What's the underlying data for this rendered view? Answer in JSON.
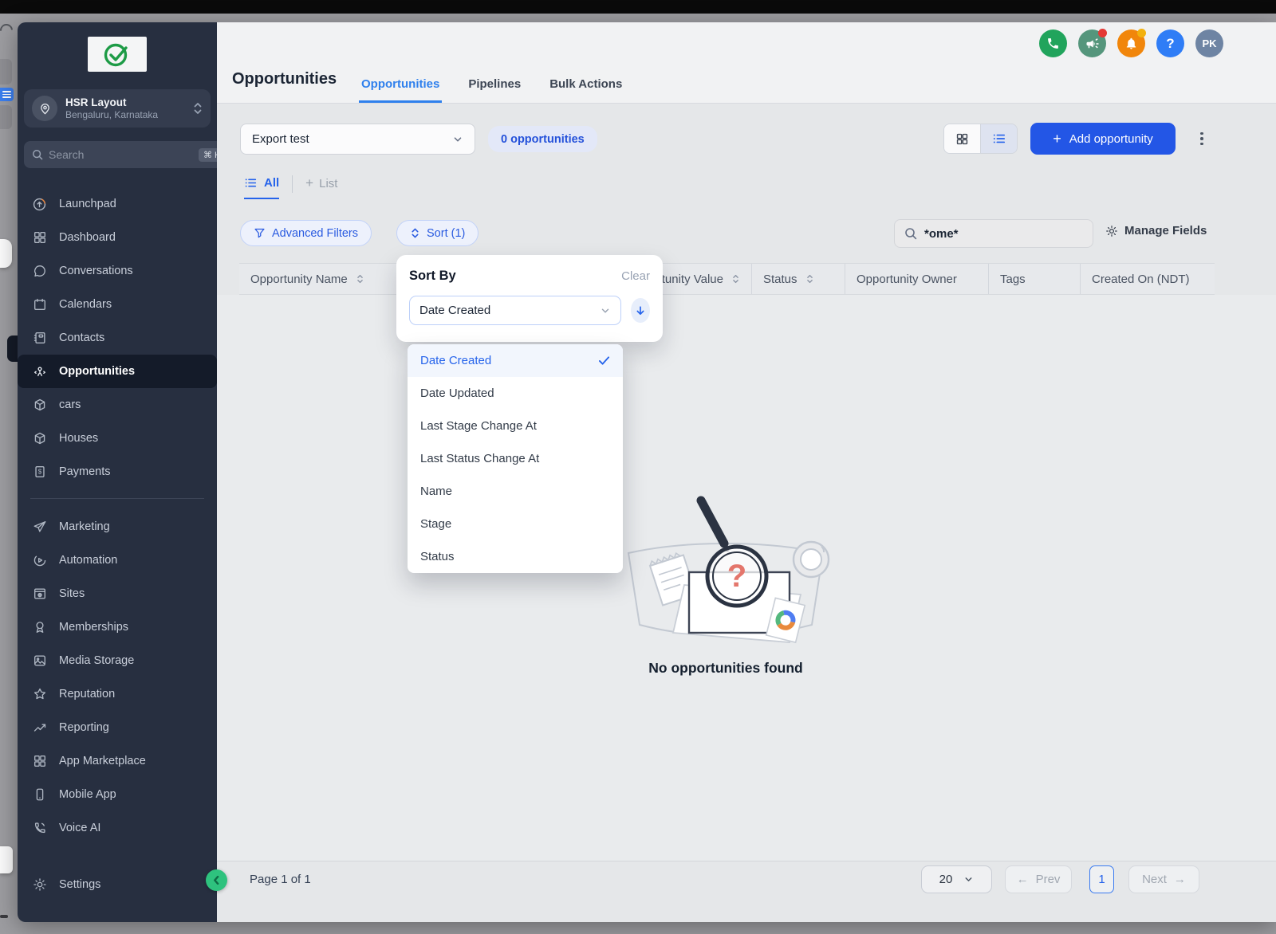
{
  "colors": {
    "accent_blue": "#2356e6",
    "tab_blue": "#2f80ed",
    "sidebar_bg": "#272f40",
    "phone_green": "#21a45c",
    "megaphone_green": "#55967c",
    "bell_orange": "#f1860b",
    "help_blue": "#2f7df6",
    "collapse_green": "#2ec27e",
    "logo_check_green": "#1d9b46"
  },
  "sidebar": {
    "location": {
      "name": "HSR Layout",
      "subtitle": "Bengaluru, Karnataka"
    },
    "search": {
      "placeholder": "Search",
      "shortcut": "⌘ K"
    },
    "nav_primary": [
      {
        "label": "Launchpad"
      },
      {
        "label": "Dashboard"
      },
      {
        "label": "Conversations"
      },
      {
        "label": "Calendars"
      },
      {
        "label": "Contacts"
      },
      {
        "label": "Opportunities",
        "active": true
      },
      {
        "label": "cars"
      },
      {
        "label": "Houses"
      },
      {
        "label": "Payments"
      }
    ],
    "nav_secondary": [
      {
        "label": "Marketing"
      },
      {
        "label": "Automation"
      },
      {
        "label": "Sites"
      },
      {
        "label": "Memberships"
      },
      {
        "label": "Media Storage"
      },
      {
        "label": "Reputation"
      },
      {
        "label": "Reporting"
      },
      {
        "label": "App Marketplace"
      },
      {
        "label": "Mobile App"
      },
      {
        "label": "Voice AI"
      }
    ],
    "settings_label": "Settings"
  },
  "icons": {
    "currency_glyph": "$"
  },
  "header": {
    "title": "Opportunities",
    "tabs": [
      {
        "label": "Opportunities",
        "active": true
      },
      {
        "label": "Pipelines"
      },
      {
        "label": "Bulk Actions"
      }
    ]
  },
  "topbar": {
    "help_glyph": "?",
    "avatar_initials": "PK"
  },
  "toolbar": {
    "saved_view": "Export test",
    "count_label": "0 opportunities",
    "add_label": "Add opportunity",
    "add_plus": "+"
  },
  "view_tabs": {
    "all_label": "All",
    "add_plus": "+",
    "list_label": "List"
  },
  "filters": {
    "advanced_label": "Advanced Filters",
    "sort_label": "Sort (1)",
    "search_value": "*ome*",
    "manage_fields_label": "Manage Fields"
  },
  "table": {
    "columns": [
      {
        "label": "Opportunity Name",
        "sortable": true
      },
      {
        "label": "Opportunity Value",
        "sortable": true
      },
      {
        "label": "Status",
        "sortable": true
      },
      {
        "label": "Opportunity Owner",
        "sortable": false
      },
      {
        "label": "Tags",
        "sortable": false
      },
      {
        "label": "Created On (NDT)",
        "sortable": false
      }
    ]
  },
  "sort_popup": {
    "title": "Sort By",
    "clear_label": "Clear",
    "selected_value": "Date Created",
    "options": [
      "Date Created",
      "Date Updated",
      "Last Stage Change At",
      "Last Status Change At",
      "Name",
      "Stage",
      "Status"
    ]
  },
  "empty_state": {
    "message": "No opportunities found",
    "glyph": "?"
  },
  "pagination": {
    "page_label": "Page 1 of 1",
    "page_size": "20",
    "prev_arrow": "←",
    "prev_label": "Prev",
    "current_page": "1",
    "next_label": "Next",
    "next_arrow": "→"
  }
}
